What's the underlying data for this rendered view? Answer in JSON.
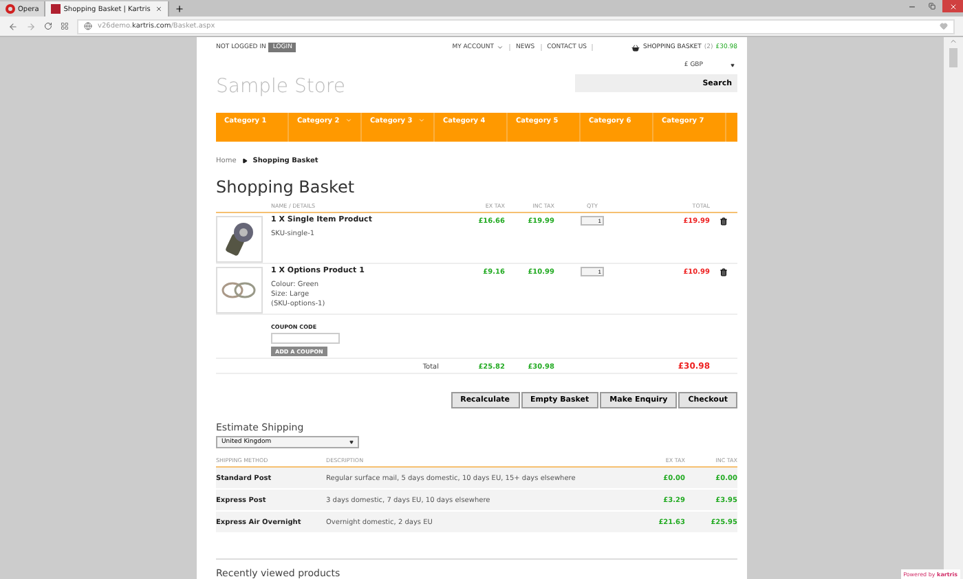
{
  "browser": {
    "tabs": [
      {
        "label": "Opera",
        "kind": "menu",
        "selected": false
      },
      {
        "label": "Shopping Basket | Kartris",
        "kind": "page",
        "selected": true
      }
    ],
    "url": "v26demo.**kartris.com**/Basket.aspx"
  },
  "top_bar": {
    "login_status": "NOT LOGGED IN",
    "login_button": "LOGIN",
    "links": [
      {
        "label": "MY ACCOUNT",
        "has_dropdown": true
      },
      {
        "label": "NEWS",
        "has_dropdown": false
      },
      {
        "label": "CONTACT US",
        "has_dropdown": false
      }
    ],
    "basket": {
      "label": "SHOPPING BASKET",
      "count": "(2)",
      "total": "£30.98"
    }
  },
  "store_name": "Sample Store",
  "currency": "£ GBP",
  "search": {
    "button": "Search"
  },
  "categories": [
    {
      "label": "Category 1",
      "has_dropdown": false
    },
    {
      "label": "Category 2",
      "has_dropdown": true
    },
    {
      "label": "Category 3",
      "has_dropdown": true
    },
    {
      "label": "Category 4",
      "has_dropdown": false
    },
    {
      "label": "Category 5",
      "has_dropdown": false
    },
    {
      "label": "Category 6",
      "has_dropdown": false
    },
    {
      "label": "Category 7",
      "has_dropdown": false
    }
  ],
  "breadcrumb": [
    "Home",
    "Shopping Basket"
  ],
  "heading": "Shopping Basket",
  "basket": {
    "columns": [
      "NAME / DETAILS",
      "EX TAX",
      "INC TAX",
      "QTY",
      "TOTAL"
    ],
    "items": [
      {
        "kind": "keyring",
        "name": "1 X Single Item Product",
        "details": [
          "SKU-single-1"
        ],
        "ex_tax": "£16.66",
        "inc_tax": "£19.99",
        "qty": "1",
        "total": "£19.99"
      },
      {
        "kind": "rings",
        "name": "1 X Options Product 1",
        "details": [
          "Colour: Green",
          "Size: Large",
          "(SKU-options-1)"
        ],
        "ex_tax": "£9.16",
        "inc_tax": "£10.99",
        "qty": "1",
        "total": "£10.99"
      }
    ],
    "coupon": {
      "label": "COUPON CODE",
      "button": "ADD A COUPON"
    },
    "totals": {
      "label": "Total",
      "ex_tax": "£25.82",
      "inc_tax": "£30.98",
      "total": "£30.98"
    },
    "buttons": [
      "Recalculate",
      "Empty Basket",
      "Make Enquiry",
      "Checkout"
    ]
  },
  "shipping": {
    "title": "Estimate Shipping",
    "country": "United Kingdom",
    "columns": [
      "SHIPPING METHOD",
      "DESCRIPTION",
      "EX TAX",
      "INC TAX"
    ],
    "rows": [
      {
        "method": "Standard Post",
        "description": "Regular surface mail, 5 days domestic, 10 days EU, 15+ days elsewhere",
        "ex_tax": "£0.00",
        "inc_tax": "£0.00"
      },
      {
        "method": "Express Post",
        "description": "3 days domestic, 7 days EU, 10 days elsewhere",
        "ex_tax": "£3.29",
        "inc_tax": "£3.95"
      },
      {
        "method": "Express Air Overnight",
        "description": "Overnight domestic, 2 days EU",
        "ex_tax": "£21.63",
        "inc_tax": "£25.95"
      }
    ]
  },
  "recently_viewed": "Recently viewed products",
  "powered_by": {
    "label": "Powered by",
    "brand": "kartris"
  }
}
